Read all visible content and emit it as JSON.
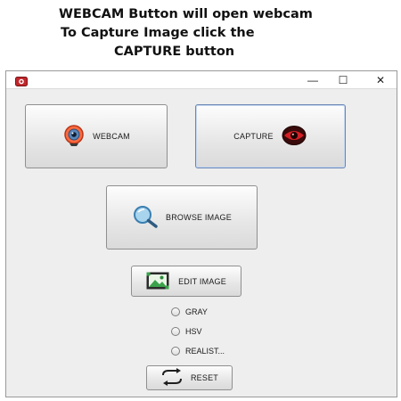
{
  "caption": {
    "line1": "WEBCAM Button will open webcam",
    "line2": "To Capture Image  click the",
    "line3": "CAPTURE button"
  },
  "window": {
    "controls": {
      "minimize": "—",
      "maximize": "☐",
      "close": "✕"
    }
  },
  "buttons": {
    "webcam": "WEBCAM",
    "capture": "CAPTURE",
    "browse": "BROWSE IMAGE",
    "edit": "EDIT IMAGE",
    "reset": "RESET"
  },
  "filters": [
    {
      "label": "GRAY"
    },
    {
      "label": "HSV"
    },
    {
      "label": "REALIST..."
    }
  ],
  "icons": {
    "app": "app-icon",
    "webcam": "webcam-icon",
    "capture": "capture-eye-icon",
    "browse": "magnifier-icon",
    "edit": "picture-icon",
    "reset": "refresh-icon"
  },
  "colors": {
    "accent_red": "#c0282d",
    "capture_border": "#6a87b5",
    "window_bg": "#eeeeee"
  }
}
